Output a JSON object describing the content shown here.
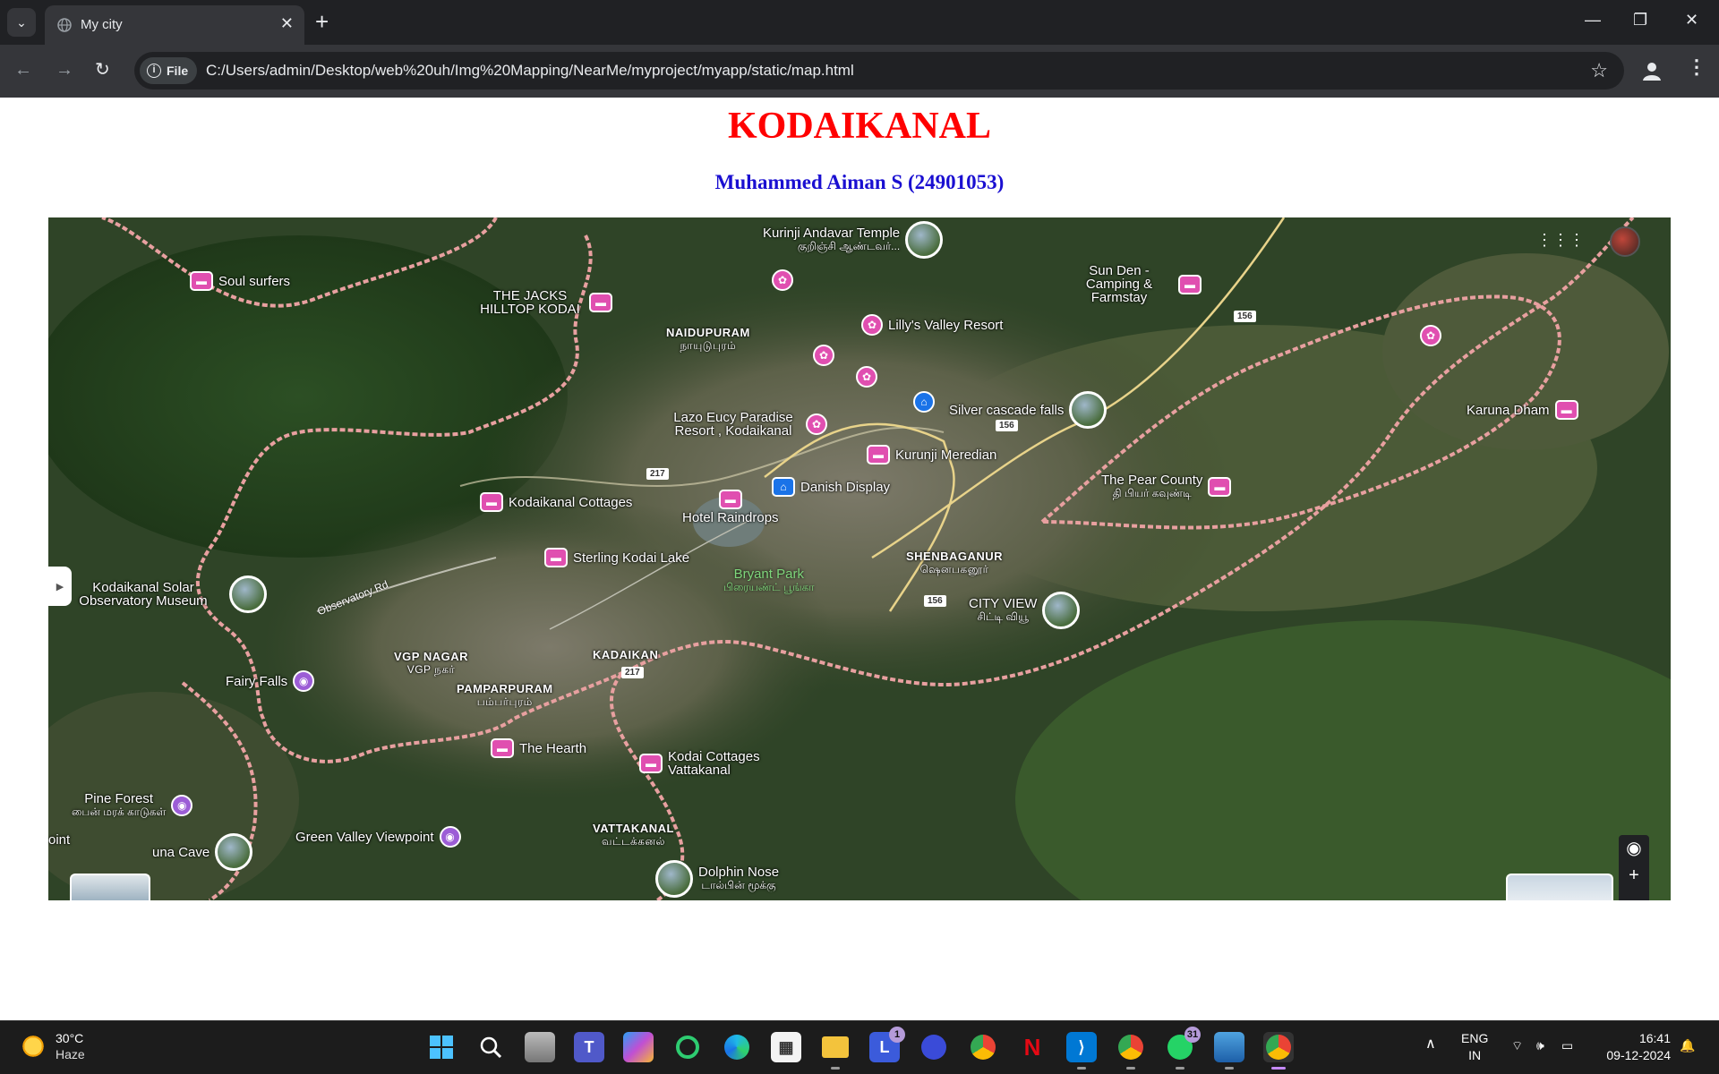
{
  "browser": {
    "tab_title": "My city",
    "new_tab": "+",
    "url_chip": "File",
    "url": "C:/Users/admin/Desktop/web%20uh/Img%20Mapping/NearMe/myproject/myapp/static/map.html"
  },
  "page": {
    "title": "KODAIKANAL",
    "subtitle": "Muhammed Aiman S (24901053)"
  },
  "map": {
    "pois": [
      {
        "name": "Kurinji Andavar Temple",
        "sub": "குறிஞ்சி ஆண்டவர்...",
        "icon": "photo"
      },
      {
        "name": "Soul surfers",
        "icon": "hotel"
      },
      {
        "name": "THE JACKS HILLTOP KODAI",
        "icon": "hotel"
      },
      {
        "name": "Sun Den - Camping & Farmstay",
        "icon": "hotel"
      },
      {
        "name": "Lilly's Valley Resort",
        "icon": "resort"
      },
      {
        "name": "Lazo Eucy Paradise Resort , Kodaikanal",
        "icon": "resort"
      },
      {
        "name": "Silver cascade falls",
        "icon": "photo"
      },
      {
        "name": "Karuna Dham",
        "icon": "hotel"
      },
      {
        "name": "Kurunji Meredian",
        "icon": "hotel"
      },
      {
        "name": "Danish Display",
        "icon": "shop"
      },
      {
        "name": "Kodaikanal Cottages",
        "icon": "hotel"
      },
      {
        "name": "Hotel Raindrops",
        "icon": "hotel"
      },
      {
        "name": "The Pear County",
        "sub": "தி பியர் கவுண்டி",
        "icon": "hotel"
      },
      {
        "name": "Sterling Kodai Lake",
        "icon": "hotel"
      },
      {
        "name": "Kodaikanal Solar Observatory Museum",
        "icon": "photo"
      },
      {
        "name": "CITY VIEW",
        "sub": "சிட்டி வியூ",
        "icon": "photo"
      },
      {
        "name": "Fairy Falls",
        "icon": "camera"
      },
      {
        "name": "The Hearth",
        "icon": "hotel"
      },
      {
        "name": "Kodai Cottages Vattakanal",
        "icon": "hotel"
      },
      {
        "name": "Pine Forest",
        "sub": "பைன் மரக் காடுகள்",
        "icon": "camera"
      },
      {
        "name": "una Cave",
        "icon": "photo"
      },
      {
        "name": "Green Valley Viewpoint",
        "icon": "camera"
      },
      {
        "name": "Dolphin Nose",
        "sub": "டால்பின் மூக்கு",
        "icon": "photo"
      },
      {
        "name": "oint",
        "icon": "none"
      }
    ],
    "areas": [
      {
        "name": "NAIDUPURAM",
        "sub": "நாயுடுபுரம்"
      },
      {
        "name": "SHENBAGANUR",
        "sub": "ஷெனபகனூர்"
      },
      {
        "name": "VGP NAGAR",
        "sub": "VGP நகர்"
      },
      {
        "name": "PAMPARPURAM",
        "sub": "பம்பர்புரம்"
      },
      {
        "name": "KADAIKAN",
        "sub": ""
      },
      {
        "name": "VATTAKANAL",
        "sub": "வட்டக்கனல்"
      }
    ],
    "park": {
      "name": "Bryant Park",
      "sub": "பிரையண்ட் பூங்கா"
    },
    "roads": [
      "217",
      "217",
      "156",
      "156",
      "156"
    ],
    "road_name": "Observatory Rd",
    "controls": {
      "zoom_in": "+",
      "zoom_out": "−"
    }
  },
  "taskbar": {
    "temperature": "30°C",
    "condition": "Haze",
    "lang_top": "ENG",
    "lang_bottom": "IN",
    "time": "16:41",
    "date": "09-12-2024",
    "badges": {
      "l_app": "1",
      "whatsapp": "31"
    }
  },
  "colors": {
    "title": "#ff0000",
    "subtitle": "#1a0fd1",
    "poi_pink": "#e04fb0",
    "poi_purple": "#9c5dd6",
    "boundary": "#e8a0a0"
  }
}
